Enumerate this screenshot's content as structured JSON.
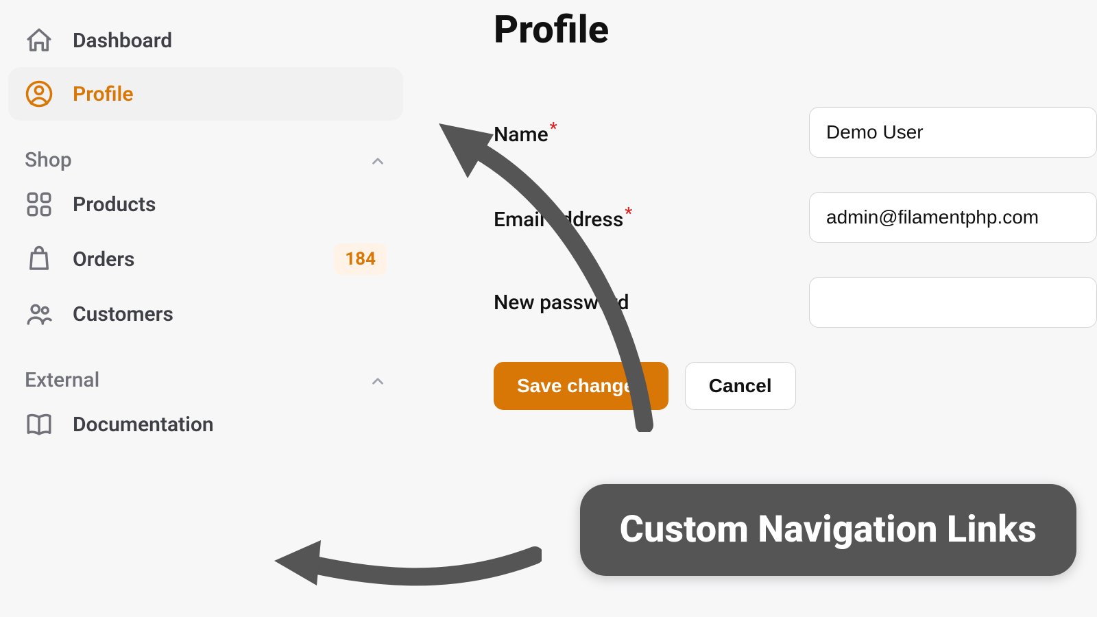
{
  "sidebar": {
    "items": [
      {
        "label": "Dashboard"
      },
      {
        "label": "Profile"
      }
    ],
    "groups": [
      {
        "title": "Shop",
        "items": [
          {
            "label": "Products"
          },
          {
            "label": "Orders",
            "badge": "184"
          },
          {
            "label": "Customers"
          }
        ]
      },
      {
        "title": "External",
        "items": [
          {
            "label": "Documentation"
          }
        ]
      }
    ]
  },
  "page": {
    "title": "Profile",
    "fields": {
      "name": {
        "label": "Name",
        "value": "Demo User"
      },
      "email": {
        "label": "Email address",
        "value": "admin@filamentphp.com"
      },
      "password": {
        "label": "New password",
        "value": ""
      }
    },
    "actions": {
      "save": "Save changes",
      "cancel": "Cancel"
    }
  },
  "annotation": {
    "callout": "Custom Navigation Links"
  }
}
